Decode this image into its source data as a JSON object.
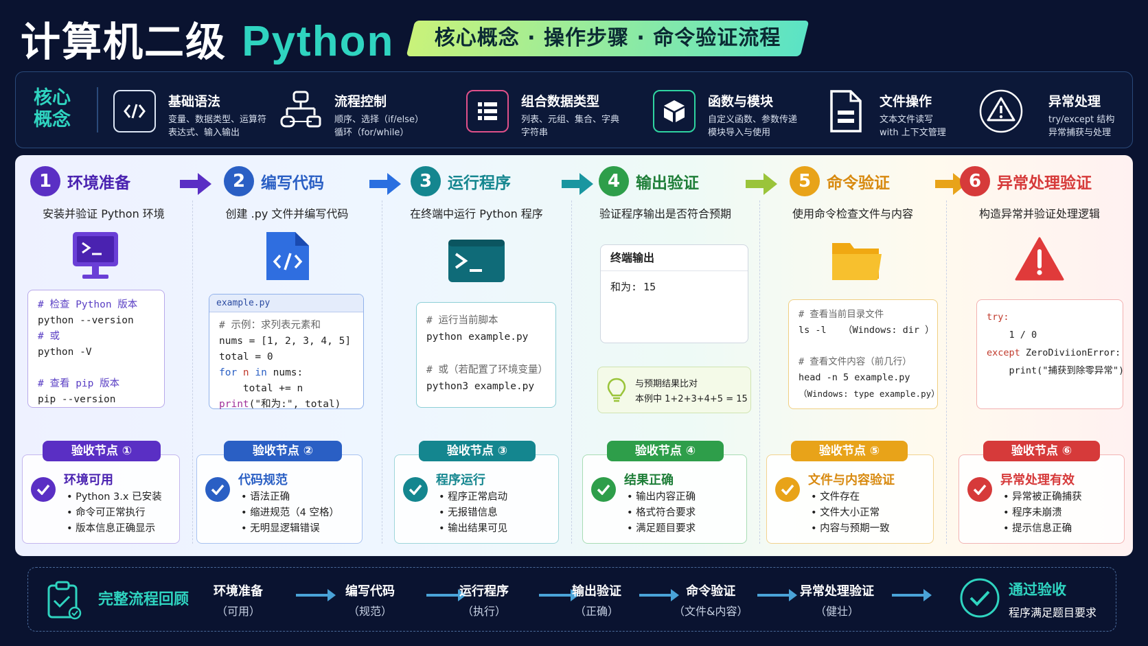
{
  "header": {
    "title_cn": "计算机二级",
    "title_py": "Python",
    "subtitle": "核心概念 · 操作步骤 · 命令验证流程"
  },
  "concepts": {
    "label_line1": "核心",
    "label_line2": "概念",
    "items": [
      {
        "title": "基础语法",
        "desc1": "变量、数据类型、运算符",
        "desc2": "表达式、输入输出",
        "icon": "code-icon"
      },
      {
        "title": "流程控制",
        "desc1": "顺序、选择（if/else）",
        "desc2": "循环（for/while）",
        "icon": "flowchart-icon"
      },
      {
        "title": "组合数据类型",
        "desc1": "列表、元组、集合、字典",
        "desc2": "字符串",
        "icon": "list-icon"
      },
      {
        "title": "函数与模块",
        "desc1": "自定义函数、参数传递",
        "desc2": "模块导入与使用",
        "icon": "cube-icon"
      },
      {
        "title": "文件操作",
        "desc1": "文本文件读写",
        "desc2": "with 上下文管理",
        "icon": "file-icon"
      },
      {
        "title": "异常处理",
        "desc1": "try/except 结构",
        "desc2": "异常捕获与处理",
        "icon": "warning-icon"
      }
    ]
  },
  "steps": [
    {
      "num": "1",
      "name": "环境准备",
      "desc": "安装并验证 Python 环境",
      "color": "#5a2fc4"
    },
    {
      "num": "2",
      "name": "编写代码",
      "desc": "创建 .py 文件并编写代码",
      "color": "#2a5fc4"
    },
    {
      "num": "3",
      "name": "运行程序",
      "desc": "在终端中运行 Python 程序",
      "color": "#14868f"
    },
    {
      "num": "4",
      "name": "输出验证",
      "desc": "验证程序输出是否符合预期",
      "color": "#2e9e4a"
    },
    {
      "num": "5",
      "name": "命令验证",
      "desc": "使用命令检查文件与内容",
      "color": "#e8a319"
    },
    {
      "num": "6",
      "name": "异常处理验证",
      "desc": "构造异常并验证处理逻辑",
      "color": "#d63a3a"
    }
  ],
  "step1_code": {
    "c1": "# 检查 Python 版本",
    "l1": "python --version",
    "c2": "# 或",
    "l2": "python -V",
    "c3": "# 查看 pip 版本",
    "l3": "pip --version"
  },
  "step2_code": {
    "filename": "example.py",
    "c1": "# 示例：求列表元素和",
    "l1": "nums = [1, 2, 3, 4, 5]",
    "l2": "total = 0",
    "l3_kw1": "for",
    "l3_v": " n ",
    "l3_kw2": "in",
    "l3_rest": " nums:",
    "l4": "    total += n",
    "l5_kw": "print",
    "l5_rest": "(\"和为:\", total)"
  },
  "step3_code": {
    "c1": "# 运行当前脚本",
    "l1": "python example.py",
    "c2": "# 或（若配置了环境变量）",
    "l2": "python3 example.py"
  },
  "step4": {
    "terminal_title": "终端输出",
    "terminal_output": "和为: 15",
    "tip_line1": "与预期结果比对",
    "tip_line2": "本例中 1+2+3+4+5 = 15"
  },
  "step5_code": {
    "c1": "# 查看当前目录文件",
    "l1": "ls -l   （Windows: dir ）",
    "c2": "# 查看文件内容（前几行）",
    "l2": "head -n 5 example.py",
    "l3": "（Windows: type example.py）"
  },
  "step6_code": {
    "l1": "try:",
    "l2": "    1 / 0",
    "l3_kw": "except",
    "l3_rest": " ZeroDiviionError:",
    "l4": "    print(\"捕获到除零异常\")"
  },
  "checks": [
    {
      "badge": "验收节点 ①",
      "title": "环境可用",
      "items": [
        "Python 3.x 已安装",
        "命令可正常执行",
        "版本信息正确显示"
      ]
    },
    {
      "badge": "验收节点 ②",
      "title": "代码规范",
      "items": [
        "语法正确",
        "缩进规范（4 空格）",
        "无明显逻辑错误"
      ]
    },
    {
      "badge": "验收节点 ③",
      "title": "程序运行",
      "items": [
        "程序正常启动",
        "无报错信息",
        "输出结果可见"
      ]
    },
    {
      "badge": "验收节点 ④",
      "title": "结果正确",
      "items": [
        "输出内容正确",
        "格式符合要求",
        "满足题目要求"
      ]
    },
    {
      "badge": "验收节点 ⑤",
      "title": "文件与内容验证",
      "items": [
        "文件存在",
        "文件大小正常",
        "内容与预期一致"
      ]
    },
    {
      "badge": "验收节点 ⑥",
      "title": "异常处理有效",
      "items": [
        "异常被正确捕获",
        "程序未崩溃",
        "提示信息正确"
      ]
    }
  ],
  "review": {
    "label": "完整流程回顾",
    "steps": [
      {
        "a": "环境准备",
        "b": "（可用）"
      },
      {
        "a": "编写代码",
        "b": "（规范）"
      },
      {
        "a": "运行程序",
        "b": "（执行）"
      },
      {
        "a": "输出验证",
        "b": "（正确）"
      },
      {
        "a": "命令验证",
        "b": "（文件&内容）"
      },
      {
        "a": "异常处理验证",
        "b": "（健壮）"
      }
    ],
    "pass_title": "通过验收",
    "pass_desc": "程序满足题目要求"
  }
}
